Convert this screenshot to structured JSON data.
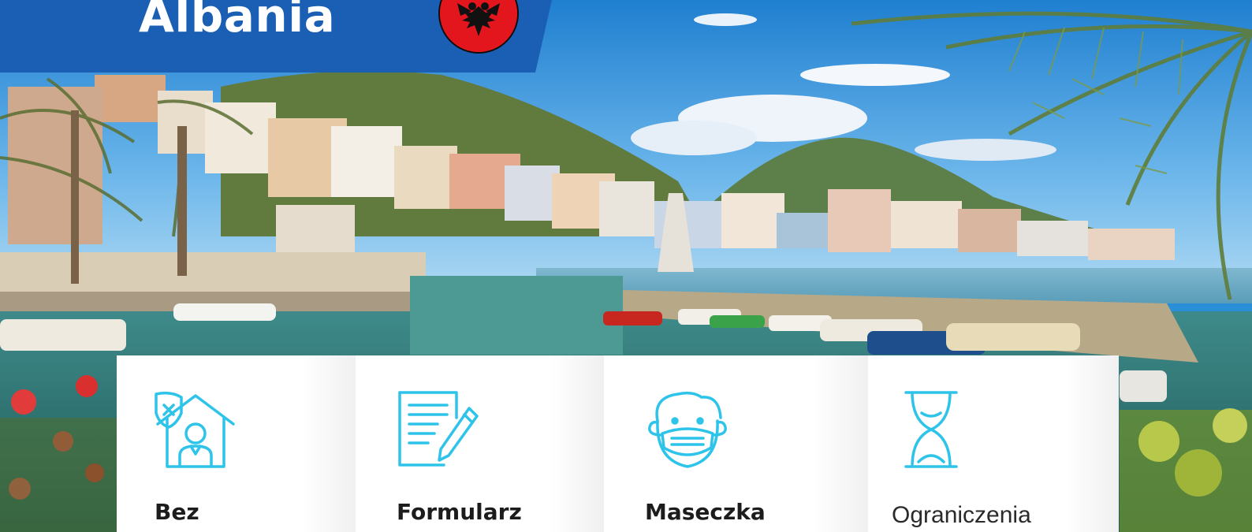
{
  "header": {
    "country_name": "Albania",
    "flag_icon": "albania-flag-icon"
  },
  "colors": {
    "banner_blue": "#1a5fb4",
    "icon_cyan": "#2ec4ea",
    "flag_red": "#e3161d"
  },
  "cards": [
    {
      "label": "Bez",
      "icon": "house-quarantine-icon"
    },
    {
      "label": "Formularz",
      "icon": "form-pen-icon"
    },
    {
      "label": "Maseczka",
      "icon": "face-mask-icon"
    },
    {
      "label": "Ograniczenia",
      "icon": "hourglass-icon"
    }
  ]
}
